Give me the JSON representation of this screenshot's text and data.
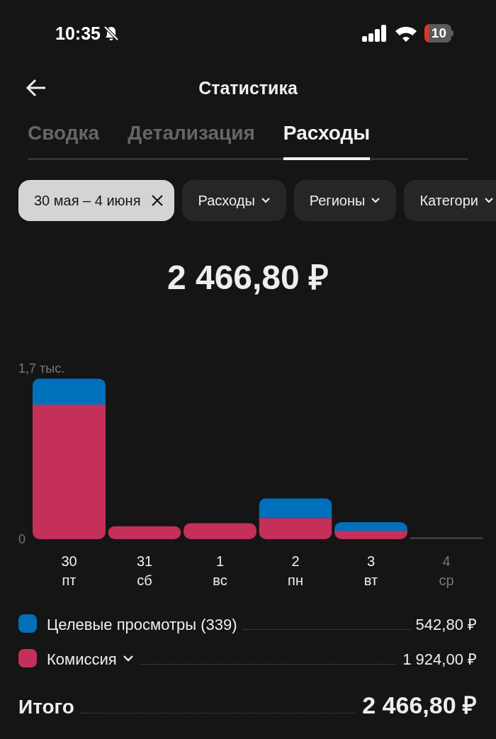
{
  "status_bar": {
    "time": "10:35",
    "battery": "10"
  },
  "header": {
    "title": "Статистика"
  },
  "tabs": [
    {
      "label": "Сводка",
      "selected": false
    },
    {
      "label": "Детализация",
      "selected": false
    },
    {
      "label": "Расходы",
      "selected": true
    }
  ],
  "filters": [
    {
      "kind": "date",
      "label": "30 мая – 4 июня",
      "selected": true
    },
    {
      "kind": "dropdown",
      "label": "Расходы",
      "selected": false
    },
    {
      "kind": "dropdown",
      "label": "Регионы",
      "selected": false
    },
    {
      "kind": "dropdown",
      "label": "Категори",
      "selected": false
    }
  ],
  "total": "2 466,80 ₽",
  "chart": {
    "weekdays": [
      "пт",
      "сб",
      "вс",
      "пн",
      "вт",
      "ср"
    ],
    "days_disabled": [
      false,
      false,
      false,
      false,
      false,
      true
    ],
    "chart_data": {
      "type": "bar",
      "stacked": true,
      "categories": [
        "30",
        "31",
        "1",
        "2",
        "3",
        "4"
      ],
      "yticks": [
        0,
        {
          "value": 1.7,
          "label": "1,7 тыс."
        }
      ],
      "ylim": [
        0,
        1.7
      ],
      "series": [
        {
          "name": "Комиссия",
          "color": "#c4305a",
          "values": [
            1.34,
            0.13,
            0.16,
            0.21,
            0.084,
            null
          ]
        },
        {
          "name": "Целевые просмотры",
          "color": "#0070bb",
          "values": [
            0.26,
            0,
            0,
            0.197,
            0.086,
            null
          ]
        }
      ]
    }
  },
  "legend": [
    {
      "count": "(339)",
      "value": "542,80 ₽",
      "expandable": false
    },
    {
      "value": "1 924,00 ₽",
      "expandable": true
    }
  ],
  "summary": {
    "label": "Итого",
    "value": "2 466,80 ₽"
  }
}
